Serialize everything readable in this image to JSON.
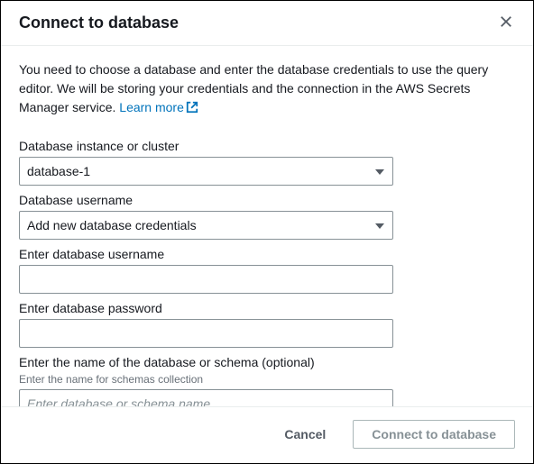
{
  "header": {
    "title": "Connect to database"
  },
  "description": {
    "text_before_link": "You need to choose a database and enter the database credentials to use the query editor. We will be storing your credentials and the connection in the AWS Secrets Manager service. ",
    "link_text": "Learn more"
  },
  "fields": {
    "instance": {
      "label": "Database instance or cluster",
      "value": "database-1"
    },
    "username_select": {
      "label": "Database username",
      "value": "Add new database credentials"
    },
    "username_input": {
      "label": "Enter database username",
      "value": ""
    },
    "password_input": {
      "label": "Enter database password",
      "value": ""
    },
    "schema_input": {
      "label": "Enter the name of the database or schema (optional)",
      "sublabel": "Enter the name for schemas collection",
      "placeholder": "Enter database or schema name",
      "value": ""
    }
  },
  "footer": {
    "cancel_label": "Cancel",
    "submit_label": "Connect to database"
  }
}
